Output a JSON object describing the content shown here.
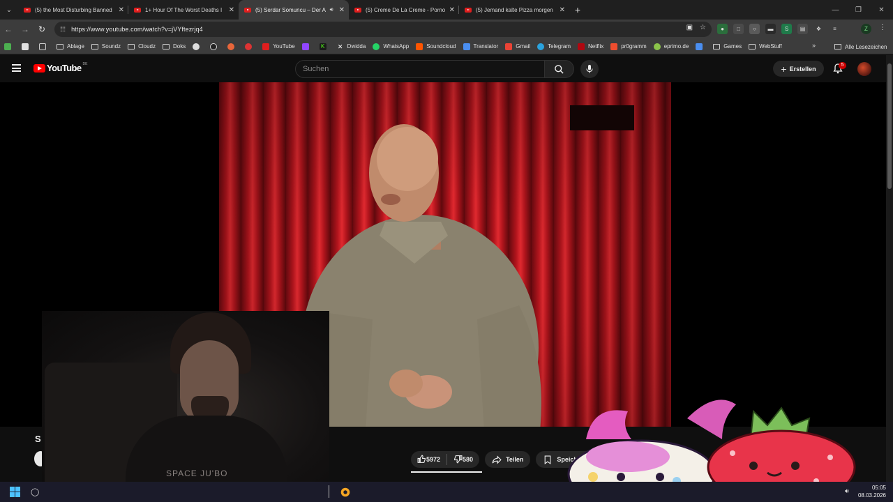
{
  "browser": {
    "tabs": [
      {
        "title": "(5) the Most Disturbing Banned",
        "active": false
      },
      {
        "title": "1+ Hour Of The Worst Deaths I",
        "active": false
      },
      {
        "title": "(5) Serdar Somuncu – Der A",
        "active": true,
        "audio": true
      },
      {
        "title": "(5) Creme De La Creme - Porno",
        "active": false
      },
      {
        "title": "(5) Jemand kalte Pizza morgen",
        "active": false
      }
    ],
    "url": "https://www.youtube.com/watch?v=jVYftezrjq4",
    "profile_letter": "Z",
    "bookmarks": [
      {
        "label": "Ablage",
        "type": "folder"
      },
      {
        "label": "Soundz",
        "type": "folder"
      },
      {
        "label": "Cloudz",
        "type": "folder"
      },
      {
        "label": "Doks",
        "type": "folder"
      },
      {
        "label": "YouTube",
        "type": "link",
        "color": "#e01e1e"
      },
      {
        "label": "Dwidda",
        "type": "link",
        "color": "#ffffff"
      },
      {
        "label": "WhatsApp",
        "type": "link",
        "color": "#25d366"
      },
      {
        "label": "Soundcloud",
        "type": "link",
        "color": "#ff5500"
      },
      {
        "label": "Translator",
        "type": "link",
        "color": "#4a8ef0"
      },
      {
        "label": "Gmail",
        "type": "link",
        "color": "#ea4335"
      },
      {
        "label": "Telegram",
        "type": "link",
        "color": "#2aa3de"
      },
      {
        "label": "Netflix",
        "type": "link",
        "color": "#b00710"
      },
      {
        "label": "pr0gramm",
        "type": "link",
        "color": "#ee4d2e"
      },
      {
        "label": "eprimo.de",
        "type": "link",
        "color": "#8bc34a"
      },
      {
        "label": "Games",
        "type": "folder"
      },
      {
        "label": "WebStuff",
        "type": "folder"
      }
    ],
    "all_bookmarks": "Alle Lesezeichen"
  },
  "youtube": {
    "logo_text": "YouTube",
    "country_code": "DE",
    "search_placeholder": "Suchen",
    "create_label": "Erstellen",
    "notification_count": "5",
    "title_initial": "S",
    "likes": "5972",
    "dislikes": "580",
    "share_label": "Teilen",
    "save_label": "Speichern"
  },
  "webcam": {
    "shirt_text": "SPACE JU'BO"
  },
  "taskbar": {
    "time": "05:05",
    "date": "08.03.2026"
  },
  "colors": {
    "youtube_red": "#ff0000",
    "accent_blue": "#4cc2ff",
    "background": "#0f0f0f"
  }
}
